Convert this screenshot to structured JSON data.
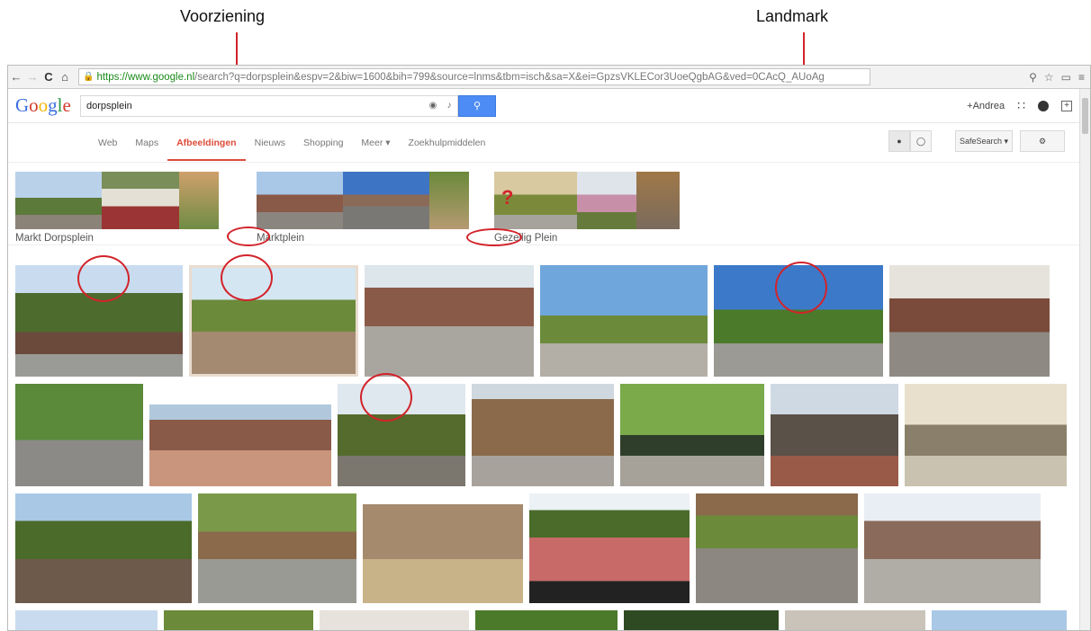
{
  "annotations": {
    "voorziening": "Voorziening",
    "landmark": "Landmark"
  },
  "browser": {
    "url_host": "https://www.google.nl",
    "url_rest": "/search?q=dorpsplein&espv=2&biw=1600&bih=799&source=lnms&tbm=isch&sa=X&ei=GpzsVKLECor3UoeQgbAG&ved=0CAcQ_AUoAg",
    "back_icon": "←",
    "forward_icon": "→",
    "reload_icon": "C",
    "home_icon": "⌂"
  },
  "google": {
    "logo": [
      "G",
      "o",
      "o",
      "g",
      "l",
      "e"
    ],
    "search_value": "dorpsplein",
    "user": "+Andrea"
  },
  "tabs": [
    "Web",
    "Maps",
    "Afbeeldingen",
    "Nieuws",
    "Shopping",
    "Meer ▾",
    "Zoekhulpmiddelen"
  ],
  "active_tab": "Afbeeldingen",
  "safesearch": "SafeSearch ▾",
  "related": [
    {
      "label": "Markt Dorpsplein"
    },
    {
      "label": "Marktplein"
    },
    {
      "label": "Gezellig Plein"
    }
  ],
  "colors": {
    "annotation_red": "#d2232a",
    "active_tab": "#dd4b39",
    "search_button": "#4d8cf5"
  }
}
